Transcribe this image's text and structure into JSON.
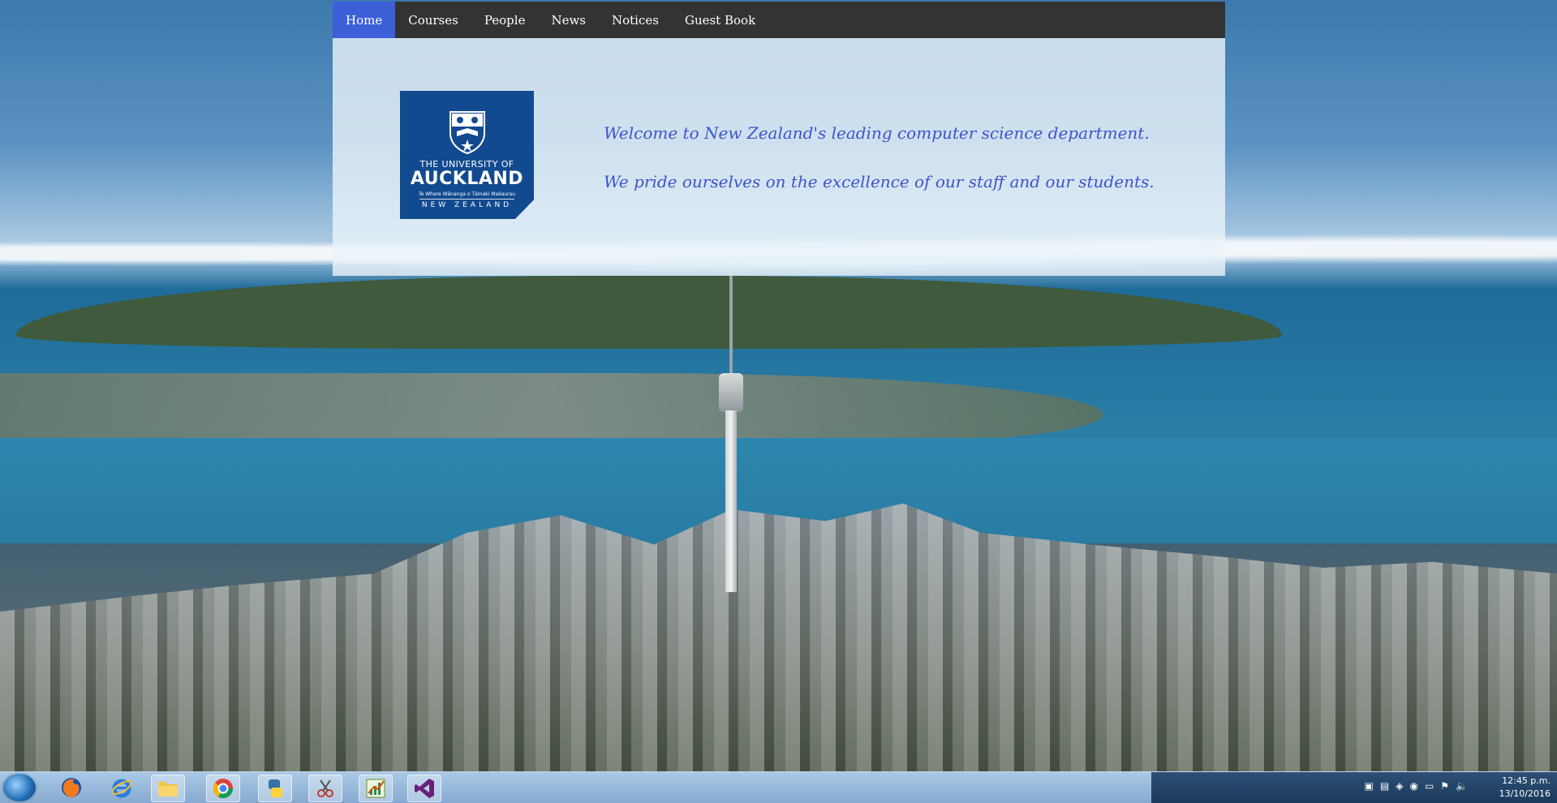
{
  "nav": {
    "items": [
      {
        "label": "Home",
        "active": true
      },
      {
        "label": "Courses"
      },
      {
        "label": "People"
      },
      {
        "label": "News"
      },
      {
        "label": "Notices"
      },
      {
        "label": "Guest Book"
      }
    ]
  },
  "logo": {
    "line1": "THE UNIVERSITY OF",
    "line2": "AUCKLAND",
    "line3": "Te Whare Wānanga o Tāmaki Makaurau",
    "line4": "NEW ZEALAND"
  },
  "welcome": {
    "line1": "Welcome to New Zealand's leading computer science department.",
    "line2": "We pride ourselves on the excellence of our staff and our students."
  },
  "taskbar": {
    "icons": [
      "start-orb",
      "firefox-icon",
      "internet-explorer-icon",
      "file-explorer-icon",
      "chrome-icon",
      "python-icon",
      "snipping-tool-icon",
      "chart-app-icon",
      "visual-studio-icon"
    ],
    "clock_time": "12:45 p.m.",
    "clock_date": "13/10/2016"
  },
  "colors": {
    "nav_bg": "#333333",
    "nav_active": "#3d5fd8",
    "logo_bg": "#124a8f",
    "welcome_text": "#3d54c9"
  }
}
